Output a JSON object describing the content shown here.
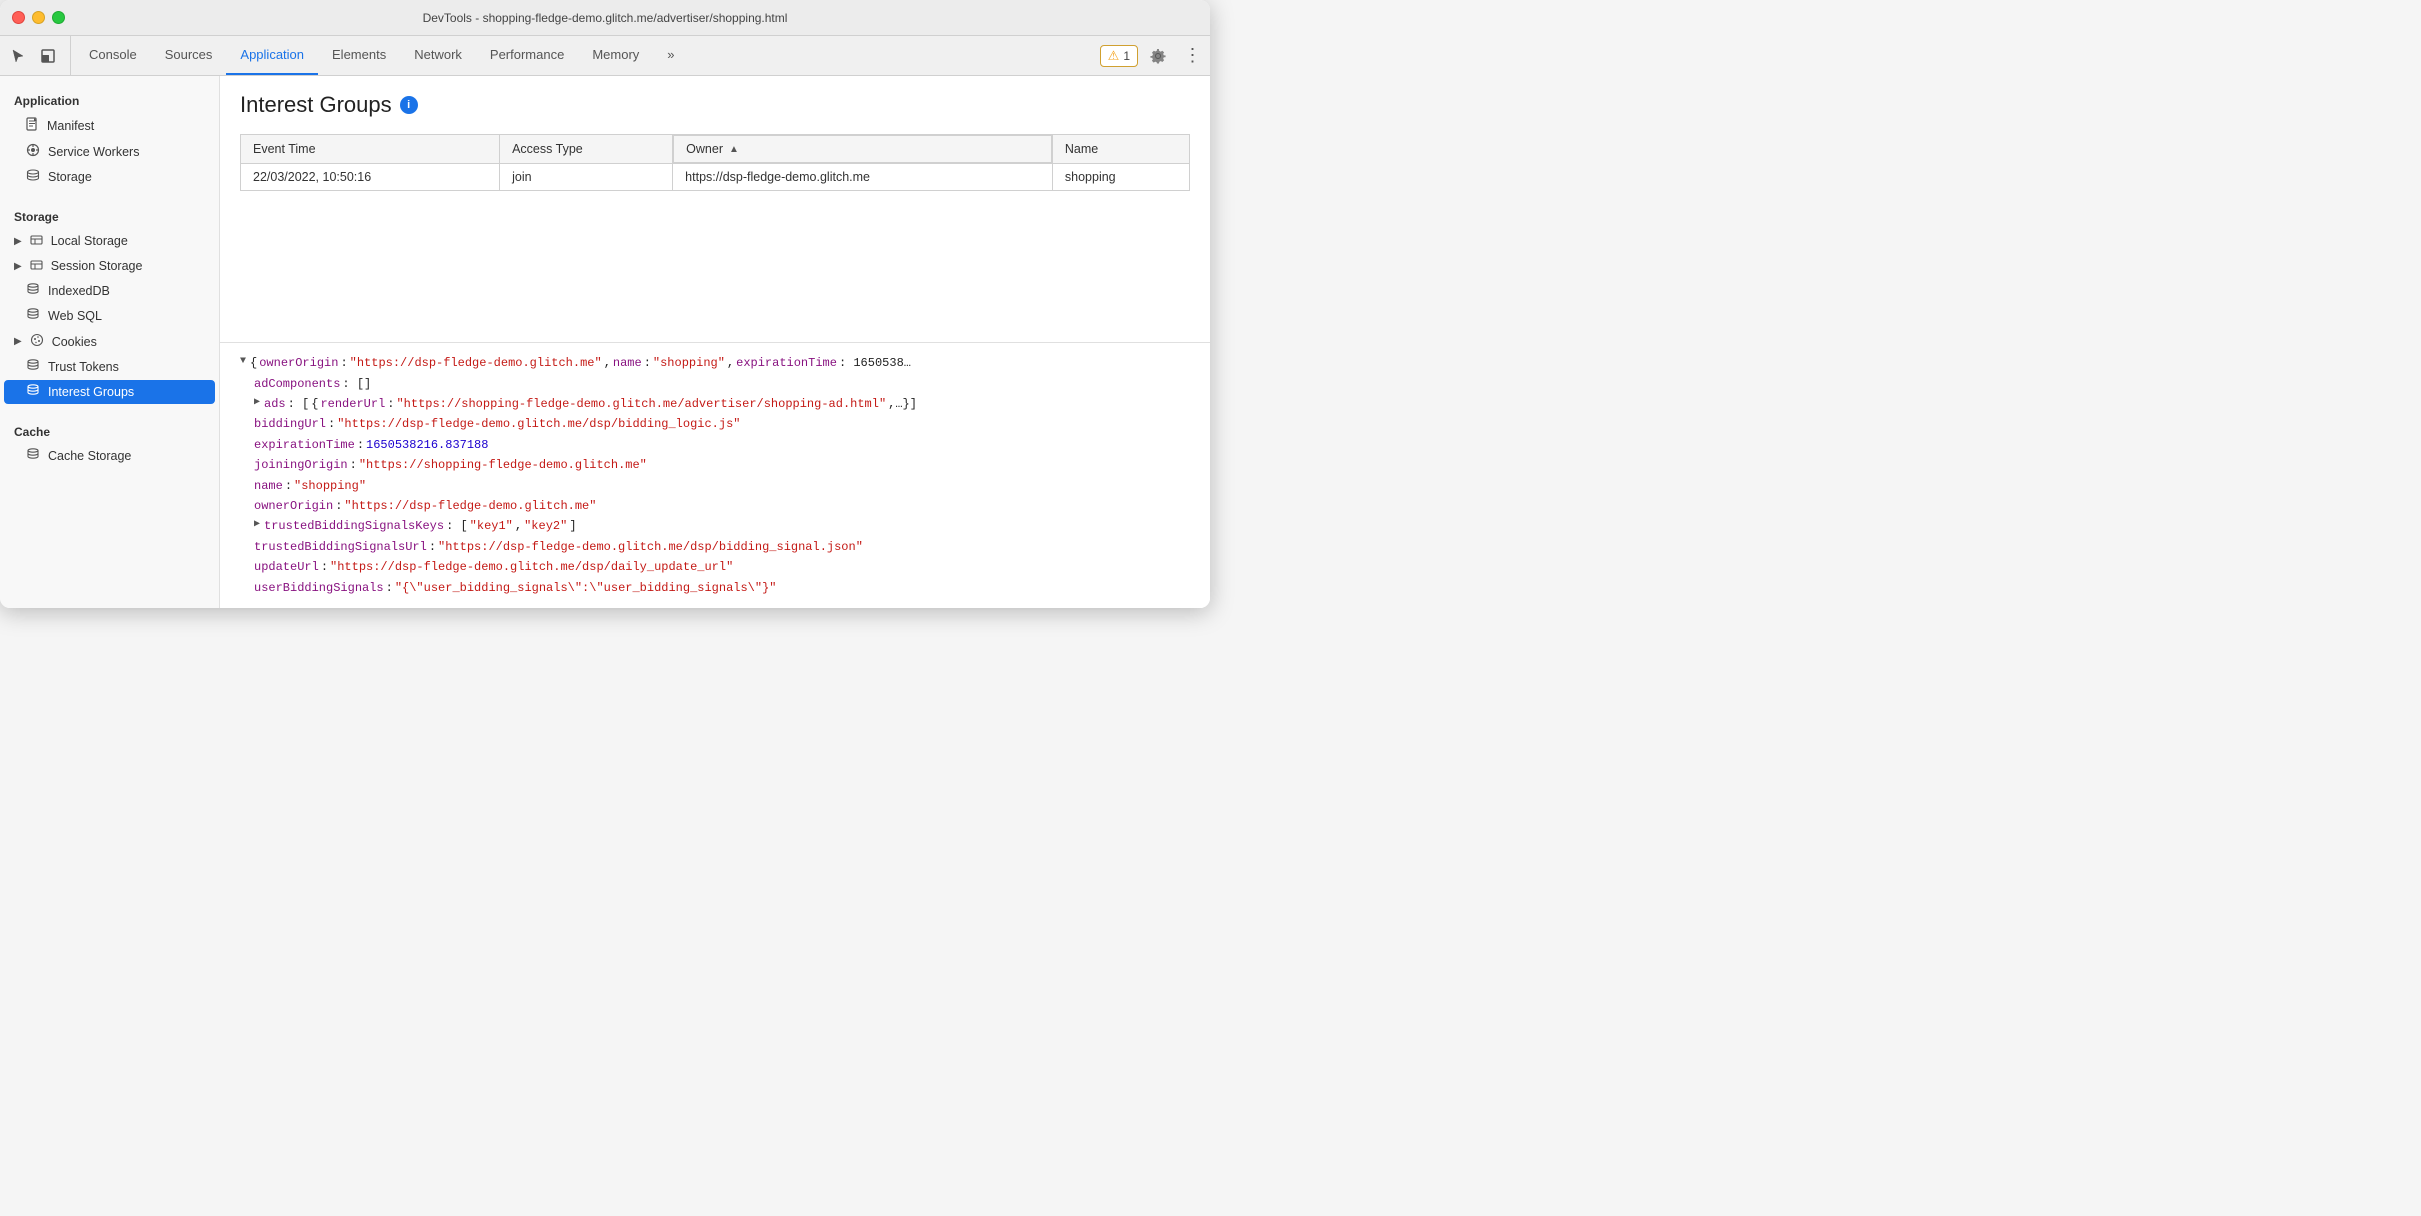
{
  "window": {
    "title": "DevTools - shopping-fledge-demo.glitch.me/advertiser/shopping.html"
  },
  "toolbar": {
    "tabs": [
      {
        "id": "console",
        "label": "Console",
        "active": false
      },
      {
        "id": "sources",
        "label": "Sources",
        "active": false
      },
      {
        "id": "application",
        "label": "Application",
        "active": true
      },
      {
        "id": "elements",
        "label": "Elements",
        "active": false
      },
      {
        "id": "network",
        "label": "Network",
        "active": false
      },
      {
        "id": "performance",
        "label": "Performance",
        "active": false
      },
      {
        "id": "memory",
        "label": "Memory",
        "active": false
      }
    ],
    "more_label": "»",
    "warning_count": "1",
    "warning_icon": "⚠"
  },
  "sidebar": {
    "application_section": "Application",
    "application_items": [
      {
        "id": "manifest",
        "label": "Manifest",
        "icon": "📄"
      },
      {
        "id": "service-workers",
        "label": "Service Workers",
        "icon": "⚙"
      },
      {
        "id": "storage",
        "label": "Storage",
        "icon": "🗄"
      }
    ],
    "storage_section": "Storage",
    "storage_items": [
      {
        "id": "local-storage",
        "label": "Local Storage",
        "icon": "▦",
        "has_arrow": true
      },
      {
        "id": "session-storage",
        "label": "Session Storage",
        "icon": "▦",
        "has_arrow": true
      },
      {
        "id": "indexeddb",
        "label": "IndexedDB",
        "icon": "🗄",
        "has_arrow": false
      },
      {
        "id": "web-sql",
        "label": "Web SQL",
        "icon": "🗄",
        "has_arrow": false
      },
      {
        "id": "cookies",
        "label": "Cookies",
        "icon": "🍪",
        "has_arrow": true
      },
      {
        "id": "trust-tokens",
        "label": "Trust Tokens",
        "icon": "🗄",
        "has_arrow": false
      },
      {
        "id": "interest-groups",
        "label": "Interest Groups",
        "icon": "🗄",
        "active": true
      }
    ],
    "cache_section": "Cache",
    "cache_items": [
      {
        "id": "cache-storage",
        "label": "Cache Storage",
        "icon": "🗄"
      }
    ]
  },
  "panel": {
    "title": "Interest Groups",
    "info_icon": "i",
    "table": {
      "columns": [
        {
          "id": "event-time",
          "label": "Event Time",
          "sorted": false
        },
        {
          "id": "access-type",
          "label": "Access Type",
          "sorted": false
        },
        {
          "id": "owner",
          "label": "Owner",
          "sorted": true,
          "sort_dir": "▲"
        },
        {
          "id": "name",
          "label": "Name",
          "sorted": false
        }
      ],
      "rows": [
        {
          "event_time": "22/03/2022, 10:50:16",
          "access_type": "join",
          "owner": "https://dsp-fledge-demo.glitch.me",
          "name": "shopping"
        }
      ]
    }
  },
  "detail": {
    "line1_prefix": "▼",
    "line1_text": "{ownerOrigin: \"https://dsp-fledge-demo.glitch.me\", name: \"shopping\", expirationTime: 1650538…",
    "line2_key": "adComponents",
    "line2_val": "[]",
    "line3_prefix": "▶",
    "line3_key": "ads",
    "line3_val": "[{renderUrl: \"https://shopping-fledge-demo.glitch.me/advertiser/shopping-ad.html\",…}]",
    "line4_key": "biddingUrl",
    "line4_val": "\"https://dsp-fledge-demo.glitch.me/dsp/bidding_logic.js\"",
    "line5_key": "expirationTime",
    "line5_val": "1650538216.837188",
    "line6_key": "joiningOrigin",
    "line6_val": "\"https://shopping-fledge-demo.glitch.me\"",
    "line7_key": "name",
    "line7_val": "\"shopping\"",
    "line8_key": "ownerOrigin",
    "line8_val": "\"https://dsp-fledge-demo.glitch.me\"",
    "line9_prefix": "▶",
    "line9_key": "trustedBiddingSignalsKeys",
    "line9_val": "[\"key1\", \"key2\"]",
    "line10_key": "trustedBiddingSignalsUrl",
    "line10_val": "\"https://dsp-fledge-demo.glitch.me/dsp/bidding_signal.json\"",
    "line11_key": "updateUrl",
    "line11_val": "\"https://dsp-fledge-demo.glitch.me/dsp/daily_update_url\"",
    "line12_key": "userBiddingSignals",
    "line12_val": "\"{\\\"user_bidding_signals\\\":\\\"user_bidding_signals\\\"}\""
  }
}
